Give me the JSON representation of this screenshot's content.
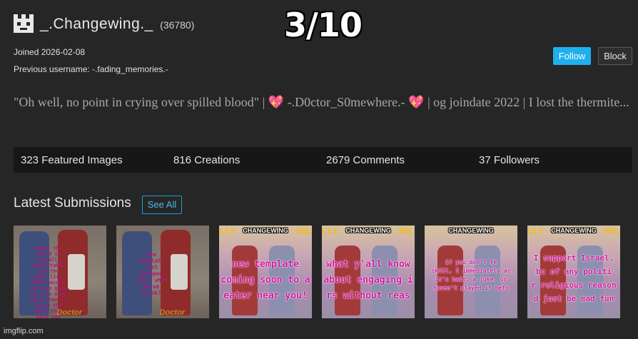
{
  "profile": {
    "username": "_.Changewing._",
    "points": "(36780)",
    "joined": "Joined 2026-02-08",
    "previous_username": "Previous username: -.fading_memories.-",
    "bio_part1": "\"Oh well, no point in crying over spilled blood\" | ",
    "bio_sparkle1": "💖",
    "bio_part2": " -.D0ctor_S0mewhere.- ",
    "bio_sparkle2": "💖",
    "bio_part3": " | og joindate 2022 | I lost the thermite..."
  },
  "overlay": {
    "rating": "3/10"
  },
  "actions": {
    "follow_label": "Follow",
    "block_label": "Block"
  },
  "stats": {
    "featured": "323 Featured Images",
    "creations": "816 Creations",
    "comments": "2679 Comments",
    "followers": "37 Followers"
  },
  "submissions": {
    "heading": "Latest Submissions",
    "see_all_label": "See All",
    "thumbs": [
      {
        "caption": "Hopes the world is actually comfortable for the right life, then become just as good as life ever give them is enjoy the most they have you bleeding",
        "label": "Doctor"
      },
      {
        "caption": "new template just dropped just, what do we think?",
        "label": "Doctor"
      },
      {
        "title": "CHANGEWING",
        "tag_left": "LLY",
        "tag_right": "MIL",
        "caption_lines": [
          "new template",
          "coming soon to a",
          "eater near you!"
        ]
      },
      {
        "title": "CHANGEWING",
        "tag_left": "LLY",
        "tag_right": "MIL",
        "caption_lines": [
          "what y'all know",
          "about engaging i",
          "rs without reas"
        ]
      },
      {
        "title": "CHANGEWING",
        "tag_left": "LLY",
        "tag_right": "MIL",
        "caption_lines": [
          "if you don't fe",
          "skill, I immediately as",
          "it's bait, a joke, or",
          "haven't played it befo"
        ]
      },
      {
        "title": "CHANGEWING",
        "tag_left": "LLY",
        "tag_right": "MIL",
        "caption_lines": [
          "I support Israel.",
          "bc of any politi",
          "r religious reason",
          "d just be mad fun"
        ]
      }
    ]
  },
  "footer": {
    "watermark": "imgflip.com"
  },
  "colors": {
    "accent": "#1fb0ee",
    "background": "#262626",
    "stats_bar": "#171717",
    "link": "#4cb8ea"
  },
  "icons": {
    "avatar": "pixel-face-icon"
  }
}
